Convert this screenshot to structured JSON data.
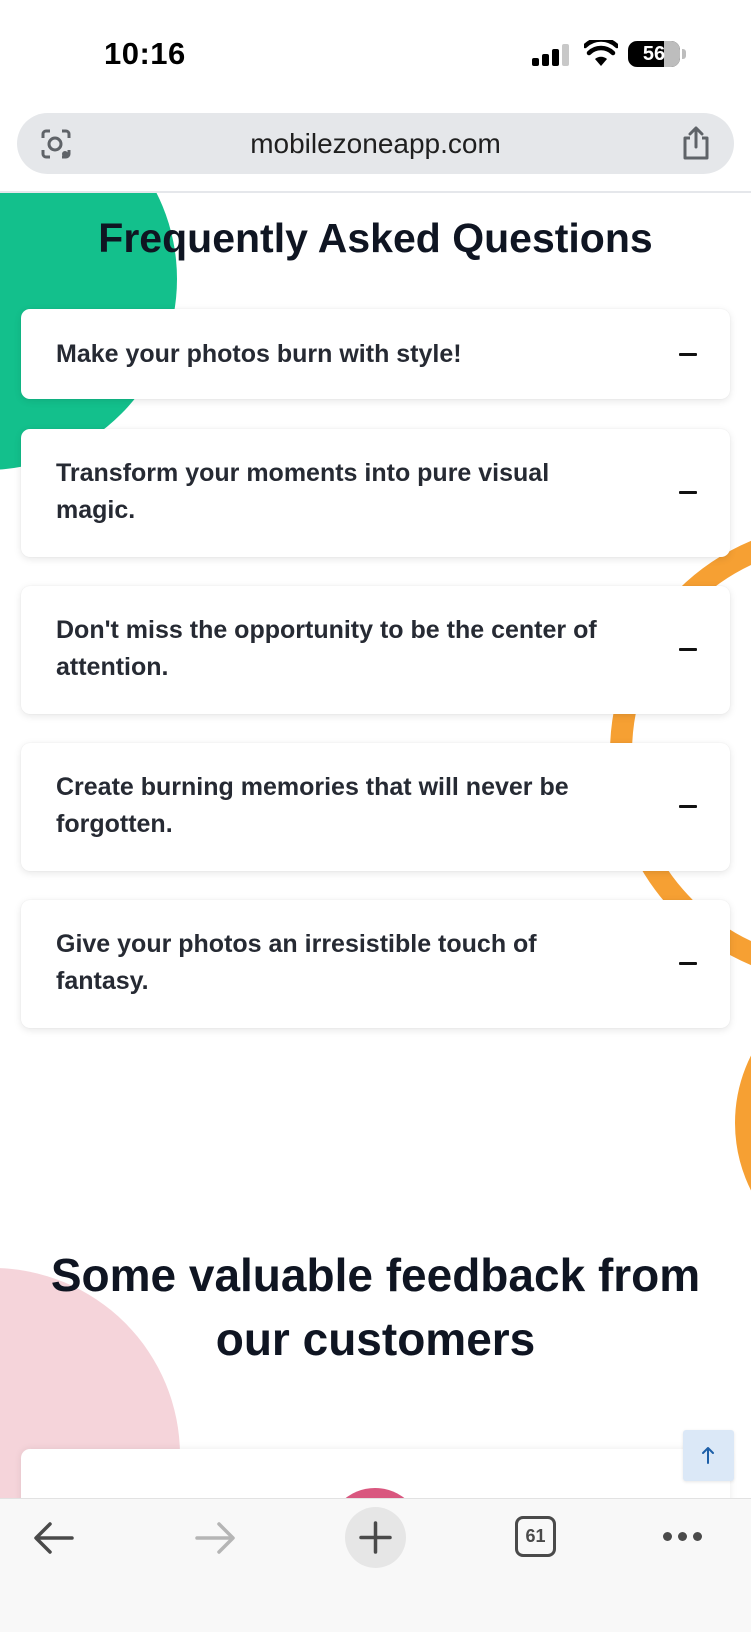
{
  "status_bar": {
    "time": "10:16",
    "battery_level": "56",
    "icons": [
      "signal-icon",
      "wifi-icon",
      "battery-icon"
    ]
  },
  "browser": {
    "url": "mobilezoneapp.com",
    "icons": [
      "lens-icon",
      "share-icon"
    ]
  },
  "faq": {
    "title": "Frequently Asked Questions",
    "items": [
      {
        "question": "Make your photos burn with style!",
        "toggle": "minus-icon"
      },
      {
        "question": "Transform your moments into pure visual magic.",
        "toggle": "minus-icon"
      },
      {
        "question": "Don't miss the opportunity to be the center of attention.",
        "toggle": "minus-icon"
      },
      {
        "question": "Create burning memories that will never be forgotten.",
        "toggle": "minus-icon"
      },
      {
        "question": "Give your photos an irresistible touch of fantasy.",
        "toggle": "minus-icon"
      }
    ]
  },
  "feedback": {
    "title": "Some valuable feedback from our customers"
  },
  "toolbar": {
    "tab_count": "61",
    "icons": [
      "back-arrow-icon",
      "forward-arrow-icon",
      "plus-icon",
      "tabs-icon",
      "more-icon"
    ]
  },
  "colors": {
    "accent_green": "#13c08c",
    "accent_orange": "#f6a033",
    "accent_pink": "#f5d4da",
    "scroll_top_bg": "#dbe8f7"
  }
}
